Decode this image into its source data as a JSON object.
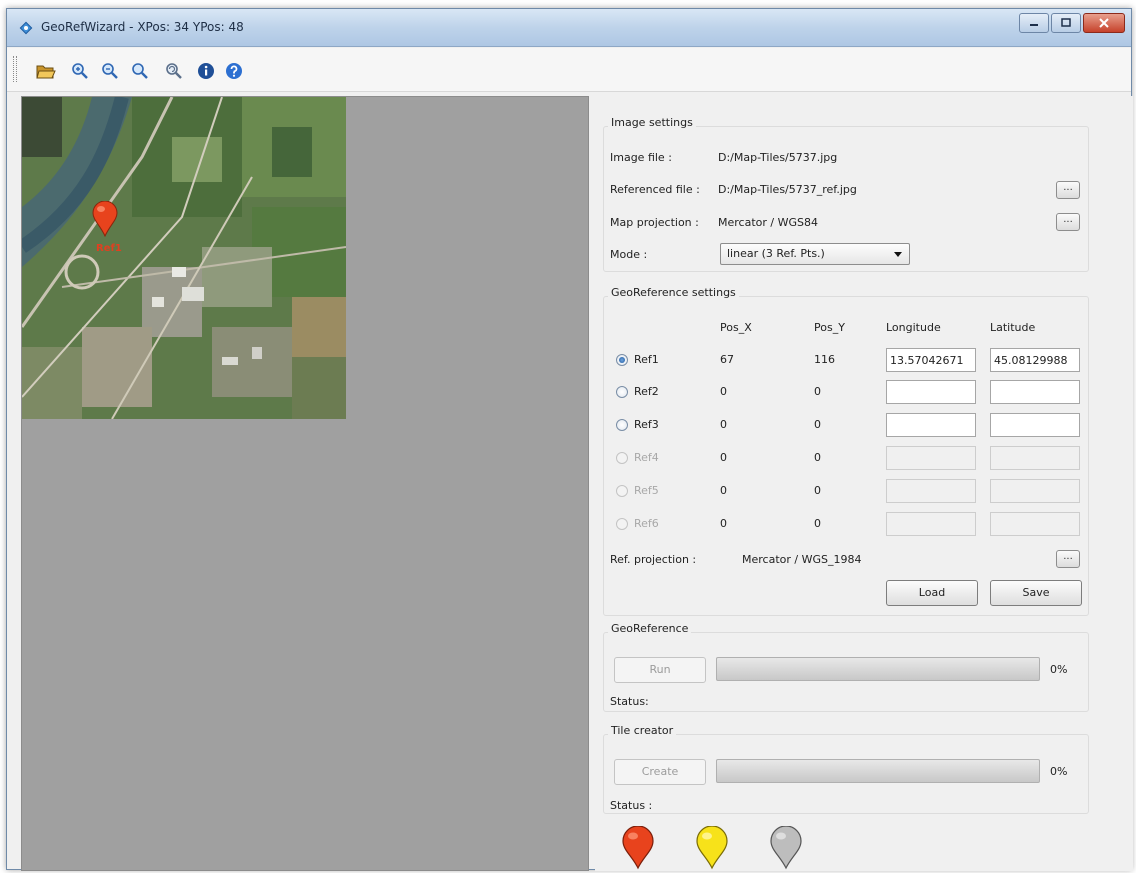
{
  "window": {
    "title": "GeoRefWizard - XPos: 34  YPos: 48"
  },
  "toolbar": {
    "icons": [
      "open-folder-icon",
      "zoom-in-icon",
      "zoom-out-icon",
      "zoom-fit-icon",
      "zoom-reset-icon",
      "info-icon",
      "help-icon"
    ]
  },
  "map": {
    "pin_label": "Ref1"
  },
  "image_settings": {
    "title": "Image settings",
    "image_file_label": "Image file :",
    "image_file_value": "D:/Map-Tiles/5737.jpg",
    "referenced_file_label": "Referenced file :",
    "referenced_file_value": "D:/Map-Tiles/5737_ref.jpg",
    "map_projection_label": "Map projection :",
    "map_projection_value": "Mercator / WGS84",
    "mode_label": "Mode :",
    "mode_value": "linear (3 Ref. Pts.)",
    "browse_label": "..."
  },
  "georef_settings": {
    "title": "GeoReference settings",
    "columns": [
      "Pos_X",
      "Pos_Y",
      "Longitude",
      "Latitude"
    ],
    "rows": [
      {
        "name": "Ref1",
        "pos_x": "67",
        "pos_y": "116",
        "longitude": "13.57042671",
        "latitude": "45.08129988"
      },
      {
        "name": "Ref2",
        "pos_x": "0",
        "pos_y": "0",
        "longitude": "",
        "latitude": ""
      },
      {
        "name": "Ref3",
        "pos_x": "0",
        "pos_y": "0",
        "longitude": "",
        "latitude": ""
      },
      {
        "name": "Ref4",
        "pos_x": "0",
        "pos_y": "0",
        "longitude": "",
        "latitude": ""
      },
      {
        "name": "Ref5",
        "pos_x": "0",
        "pos_y": "0",
        "longitude": "",
        "latitude": ""
      },
      {
        "name": "Ref6",
        "pos_x": "0",
        "pos_y": "0",
        "longitude": "",
        "latitude": ""
      }
    ],
    "ref_projection_label": "Ref. projection :",
    "ref_projection_value": "Mercator / WGS_1984",
    "load_label": "Load",
    "save_label": "Save"
  },
  "georeference": {
    "title": "GeoReference",
    "run_label": "Run",
    "progress": 0,
    "progress_text": "0%",
    "status_label": "Status:"
  },
  "tile_creator": {
    "title": "Tile creator",
    "create_label": "Create",
    "progress": 0,
    "progress_text": "0%",
    "status_label": "Status :"
  },
  "colors": {
    "marker_red": "#e8431d",
    "marker_yellow": "#f7e21a",
    "marker_gray": "#bdbdbd"
  }
}
